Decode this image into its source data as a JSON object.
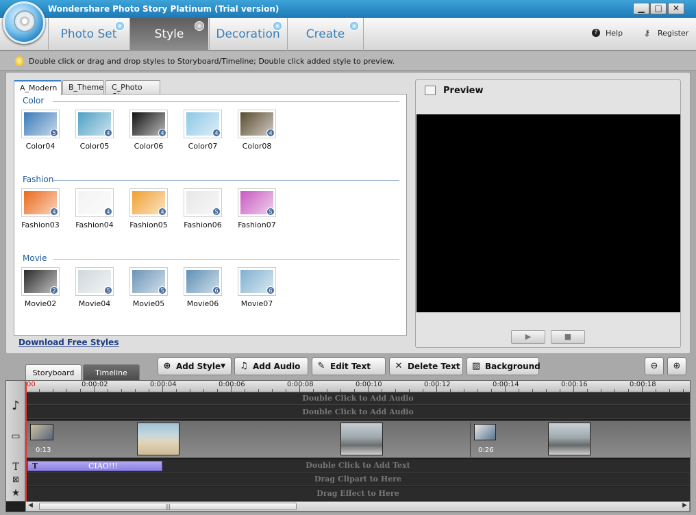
{
  "window": {
    "title": "Wondershare Photo Story Platinum  (Trial version)",
    "buttons": [
      "▁",
      "□",
      "✕"
    ]
  },
  "nav": {
    "tabs": [
      {
        "label": "Photo Set"
      },
      {
        "label": "Style"
      },
      {
        "label": "Decoration"
      },
      {
        "label": "Create"
      }
    ],
    "help": "Help",
    "register": "Register"
  },
  "hint": "Double click or drag and drop styles to Storyboard/Timeline; Double click added style to preview.",
  "style_tabs": [
    "A_Modern",
    "B_Theme",
    "C_Photo Qty"
  ],
  "sections": [
    {
      "title": "Color",
      "items": [
        {
          "label": "Color04",
          "count": "5",
          "color": "#3a7ab8"
        },
        {
          "label": "Color05",
          "count": "4",
          "color": "#4ca0c4"
        },
        {
          "label": "Color06",
          "count": "4",
          "color": "#111111"
        },
        {
          "label": "Color07",
          "count": "4",
          "color": "#8cc7e6"
        },
        {
          "label": "Color08",
          "count": "4",
          "color": "#5a4b30"
        }
      ]
    },
    {
      "title": "Fashion",
      "items": [
        {
          "label": "Fashion03",
          "count": "4",
          "color": "#e96a1b"
        },
        {
          "label": "Fashion04",
          "count": "4",
          "color": "#f3f3f3"
        },
        {
          "label": "Fashion05",
          "count": "4",
          "color": "#f0a030"
        },
        {
          "label": "Fashion06",
          "count": "5",
          "color": "#e7e7e7"
        },
        {
          "label": "Fashion07",
          "count": "5",
          "color": "#c85ac0"
        }
      ]
    },
    {
      "title": "Movie",
      "items": [
        {
          "label": "Movie02",
          "count": "2",
          "color": "#2a2a2a"
        },
        {
          "label": "Movie04",
          "count": "5",
          "color": "#cfd8dc"
        },
        {
          "label": "Movie05",
          "count": "5",
          "color": "#6a93b8"
        },
        {
          "label": "Movie06",
          "count": "6",
          "color": "#5d8fb5"
        },
        {
          "label": "Movie07",
          "count": "6",
          "color": "#7fb0d0"
        }
      ]
    }
  ],
  "download_link": "Download Free Styles",
  "preview": {
    "title": "Preview",
    "play": "▶",
    "stop": "■"
  },
  "view_tabs": {
    "storyboard": "Storyboard",
    "timeline": "Timeline"
  },
  "toolbar": {
    "add_style": "Add Style",
    "add_audio": "Add Audio",
    "edit_text": "Edit Text",
    "delete_text": "Delete Text",
    "background": "Background"
  },
  "timeline": {
    "ruler_start": "00",
    "ruler": [
      "0:00:02",
      "0:00:04",
      "0:00:06",
      "0:00:08",
      "0:00:10",
      "0:00:12",
      "0:00:14",
      "0:00:16",
      "0:00:18"
    ],
    "audio1": "Double Click to Add Audio",
    "audio2": "Double Click to Add Audio",
    "clip1_time": "0:13",
    "clip2_time": "0:26",
    "text_clip": "CIAO!!!",
    "text_track": "Double Click to Add Text",
    "clipart_track": "Drag Clipart to Here",
    "effect_track": "Drag Effect to Here",
    "scroll_grip": "|||"
  }
}
